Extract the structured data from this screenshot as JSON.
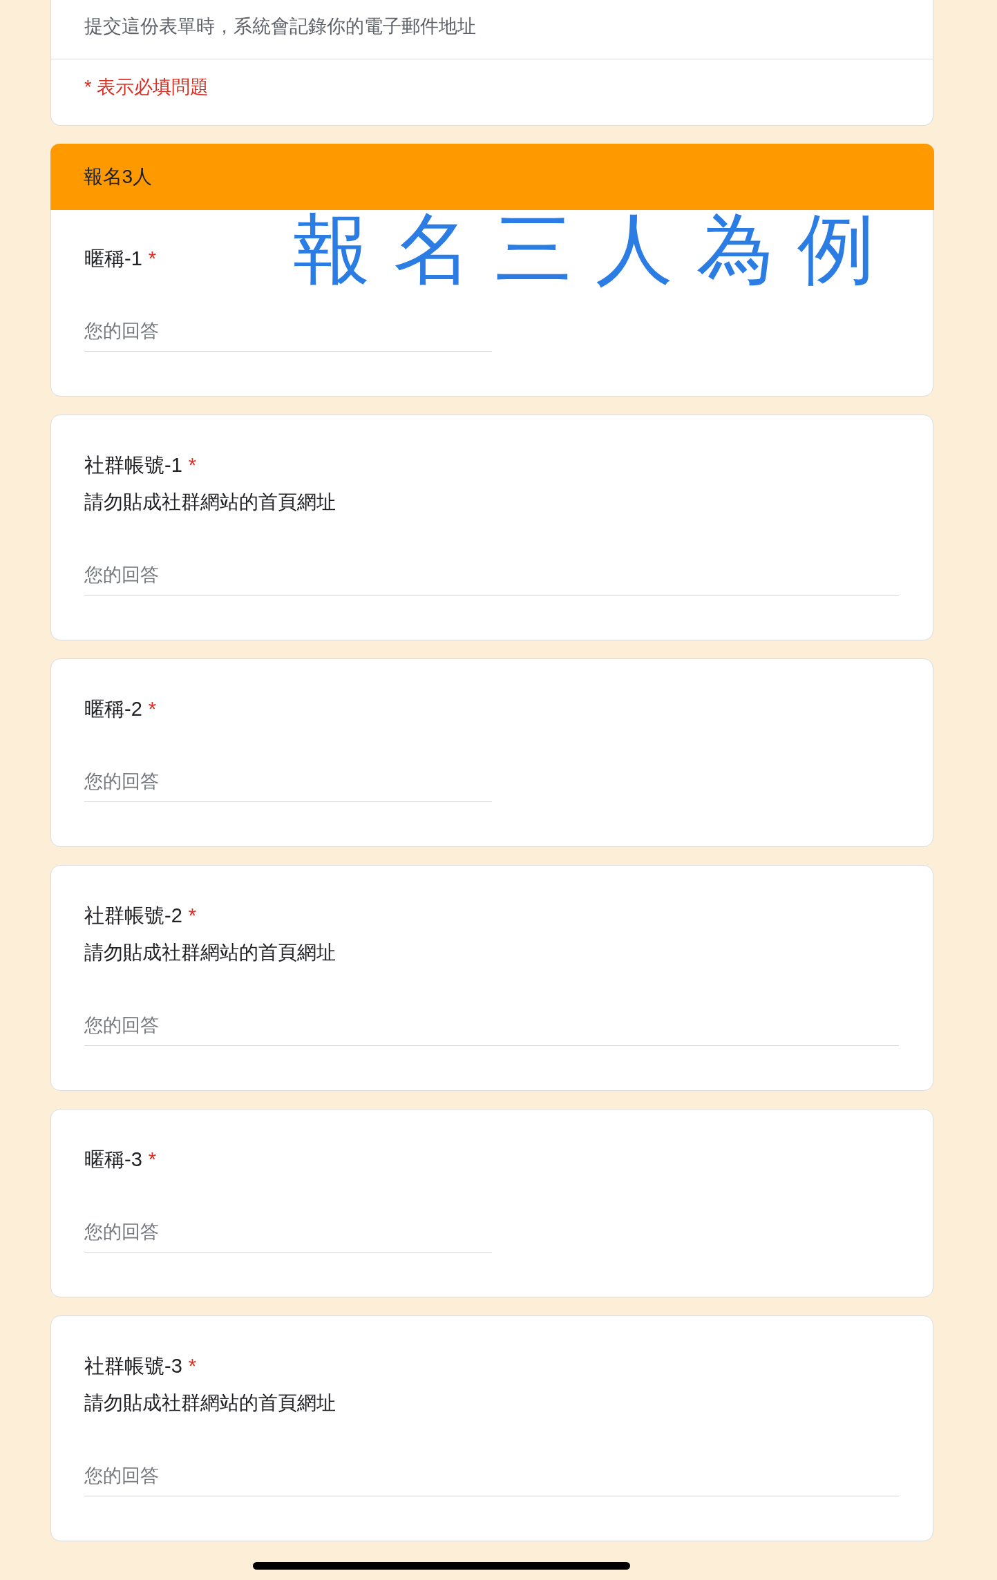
{
  "form_header": {
    "email_notice": "提交這份表單時，系統會記錄你的電子郵件地址",
    "required_notice": "* 表示必填問題"
  },
  "section": {
    "title": "報名3人",
    "questions": [
      {
        "title": "暱稱-1",
        "required_mark": "*",
        "kind": "short_answer",
        "placeholder": "您的回答"
      },
      {
        "title": "社群帳號-1",
        "required_mark": "*",
        "description": "請勿貼成社群網站的首頁網址",
        "kind": "paragraph",
        "placeholder": "您的回答"
      },
      {
        "title": "暱稱-2",
        "required_mark": "*",
        "kind": "short_answer",
        "placeholder": "您的回答"
      },
      {
        "title": "社群帳號-2",
        "required_mark": "*",
        "description": "請勿貼成社群網站的首頁網址",
        "kind": "paragraph",
        "placeholder": "您的回答"
      },
      {
        "title": "暱稱-3",
        "required_mark": "*",
        "kind": "short_answer",
        "placeholder": "您的回答"
      },
      {
        "title": "社群帳號-3",
        "required_mark": "*",
        "description": "請勿貼成社群網站的首頁網址",
        "kind": "paragraph",
        "placeholder": "您的回答"
      }
    ]
  },
  "annotation": {
    "text": "報名三人為例"
  }
}
